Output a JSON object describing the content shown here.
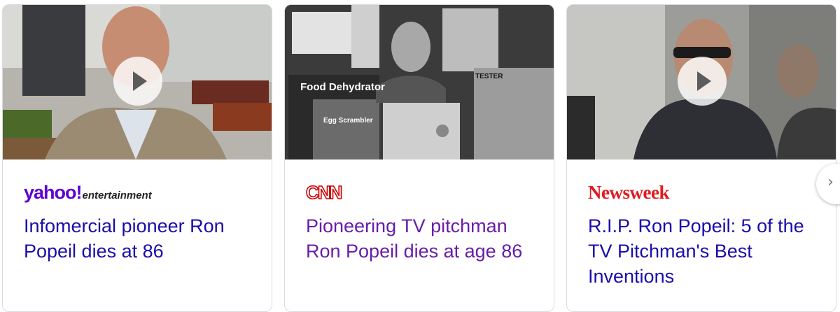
{
  "cards": [
    {
      "source_logo": "yahoo!",
      "source_logo_sub": "entertainment",
      "title": "Infomercial pioneer Ron Popeil dies at 86",
      "has_video": true,
      "visited": false
    },
    {
      "source_logo": "CNN",
      "title": "Pioneering TV pitchman Ron Popeil dies at age 86",
      "has_video": false,
      "visited": true,
      "image_text": [
        "Food Dehydrator",
        "Egg Scrambler",
        "TESTER"
      ]
    },
    {
      "source_logo": "Newsweek",
      "title": "R.I.P. Ron Popeil: 5 of the TV Pitchman's Best Inventions",
      "has_video": true,
      "visited": false
    }
  ],
  "next_button": {
    "icon": "chevron-right-icon",
    "glyph": "›"
  },
  "colors": {
    "link": "#1a0dab",
    "visited_link": "#681da8",
    "yahoo": "#6001d2",
    "cnn": "#cc0000",
    "newsweek": "#e01b22"
  }
}
